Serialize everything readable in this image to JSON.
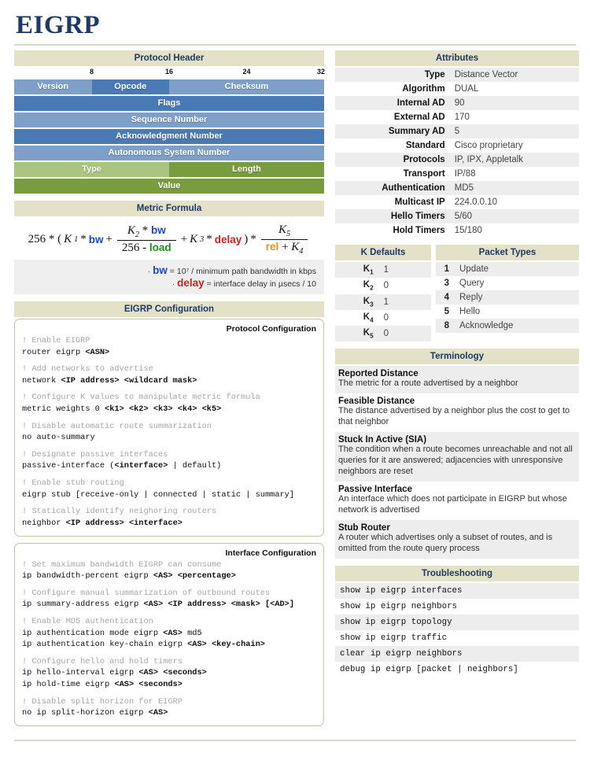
{
  "title": "EIGRP",
  "sections": {
    "protocol_header": "Protocol Header",
    "metric_formula": "Metric Formula",
    "eigrp_configuration": "EIGRP Configuration",
    "attributes": "Attributes",
    "k_defaults": "K Defaults",
    "packet_types": "Packet Types",
    "terminology": "Terminology",
    "troubleshooting": "Troubleshooting"
  },
  "packet_diagram": {
    "ruler": [
      "8",
      "16",
      "24",
      "32"
    ],
    "rows": [
      [
        {
          "label": "Version",
          "width": "w-25",
          "color": "b-light"
        },
        {
          "label": "Opcode",
          "width": "w-25",
          "color": "b-dark"
        },
        {
          "label": "Checksum",
          "width": "w-50",
          "color": "b-light"
        }
      ],
      [
        {
          "label": "Flags",
          "width": "w-100",
          "color": "b-dark"
        }
      ],
      [
        {
          "label": "Sequence Number",
          "width": "w-100",
          "color": "b-light"
        }
      ],
      [
        {
          "label": "Acknowledgment Number",
          "width": "w-100",
          "color": "b-dark"
        }
      ],
      [
        {
          "label": "Autonomous System Number",
          "width": "w-100",
          "color": "b-light"
        }
      ],
      [
        {
          "label": "Type",
          "width": "w-50",
          "color": "g-light"
        },
        {
          "label": "Length",
          "width": "w-50",
          "color": "g-dark"
        }
      ],
      [
        {
          "label": "Value",
          "width": "w-100",
          "color": "g-dark"
        }
      ]
    ]
  },
  "formula": {
    "lead": "256 * (",
    "k1": "K",
    "k1sub": "1",
    "times1": "*",
    "bw1": "bw",
    "plus1": "+",
    "k2": "K",
    "k2sub": "2",
    "times2": "*",
    "bw2": "bw",
    "den_256": "256 -",
    "load": "load",
    "plus2": "+",
    "k3": "K",
    "k3sub": "3",
    "times3": "*",
    "delay": "delay",
    "close": ")",
    "times4": "*",
    "k5": "K",
    "k5sub": "5",
    "rel": "rel",
    "plus3": "+",
    "k4": "K",
    "k4sub": "4",
    "note_bw_label": "bw",
    "note_bw_text": " = 10⁷ / minimum path bandwidth in kbps",
    "note_delay_label": "delay",
    "note_delay_text": " = interface delay in µsecs / 10"
  },
  "config": {
    "protocol": {
      "title": "Protocol Configuration",
      "blocks": [
        {
          "comment": "! Enable EIGRP",
          "lines": [
            {
              "plain": "router eigrp ",
              "bold": "<ASN>"
            }
          ]
        },
        {
          "comment": "! Add networks to advertise",
          "lines": [
            {
              "plain": "network ",
              "bold": "<IP address> <wildcard mask>"
            }
          ]
        },
        {
          "comment": "! Configure K values to manipulate metric formula",
          "lines": [
            {
              "plain": "metric weights 0 ",
              "bold": "<k1> <k2> <k3> <k4> <k5>"
            }
          ]
        },
        {
          "comment": "! Disable automatic route summarization",
          "lines": [
            {
              "plain": "no auto-summary",
              "bold": ""
            }
          ]
        },
        {
          "comment": "! Designate passive interfaces",
          "lines": [
            {
              "plain": "passive-interface (",
              "bold": "<interface>",
              "tail": " | default)"
            }
          ]
        },
        {
          "comment": "! Enable stub routing",
          "lines": [
            {
              "plain": "eigrp stub [receive-only | connected | static | summary]",
              "bold": ""
            }
          ]
        },
        {
          "comment": "! Statically identify neighoring routers",
          "lines": [
            {
              "plain": "neighbor ",
              "bold": "<IP address> <interface>"
            }
          ]
        }
      ]
    },
    "interface": {
      "title": "Interface Configuration",
      "blocks": [
        {
          "comment": "! Set maximum bandwidth EIGRP can consume",
          "lines": [
            {
              "plain": "ip bandwidth-percent eigrp ",
              "bold": "<AS> <percentage>"
            }
          ]
        },
        {
          "comment": "! Configure manual summarization of outbound routes",
          "lines": [
            {
              "plain": "ip summary-address eigrp ",
              "bold": "<AS> <IP address> <mask> [<AD>]"
            }
          ]
        },
        {
          "comment": "! Enable MD5 authentication",
          "lines": [
            {
              "plain": "ip authentication mode eigrp ",
              "bold": "<AS>",
              "tail": " md5"
            },
            {
              "plain": "ip authentication key-chain eigrp ",
              "bold": "<AS> <key-chain>"
            }
          ]
        },
        {
          "comment": "! Configure hello and hold timers",
          "lines": [
            {
              "plain": "ip hello-interval eigrp ",
              "bold": "<AS> <seconds>"
            },
            {
              "plain": "ip hold-time eigrp ",
              "bold": "<AS> <seconds>"
            }
          ]
        },
        {
          "comment": "! Disable split horizon for EIGRP",
          "lines": [
            {
              "plain": "no ip split-horizon eigrp ",
              "bold": "<AS>"
            }
          ]
        }
      ]
    }
  },
  "attributes": [
    {
      "key": "Type",
      "value": "Distance Vector"
    },
    {
      "key": "Algorithm",
      "value": "DUAL"
    },
    {
      "key": "Internal AD",
      "value": "90"
    },
    {
      "key": "External AD",
      "value": "170"
    },
    {
      "key": "Summary AD",
      "value": "5"
    },
    {
      "key": "Standard",
      "value": "Cisco proprietary"
    },
    {
      "key": "Protocols",
      "value": "IP, IPX, Appletalk"
    },
    {
      "key": "Transport",
      "value": "IP/88"
    },
    {
      "key": "Authentication",
      "value": "MD5"
    },
    {
      "key": "Multicast IP",
      "value": "224.0.0.10"
    },
    {
      "key": "Hello Timers",
      "value": "5/60"
    },
    {
      "key": "Hold Timers",
      "value": "15/180"
    }
  ],
  "k_defaults": [
    {
      "label": "K",
      "sub": "1",
      "value": "1"
    },
    {
      "label": "K",
      "sub": "2",
      "value": "0"
    },
    {
      "label": "K",
      "sub": "3",
      "value": "1"
    },
    {
      "label": "K",
      "sub": "4",
      "value": "0"
    },
    {
      "label": "K",
      "sub": "5",
      "value": "0"
    }
  ],
  "packet_types": [
    {
      "num": "1",
      "name": "Update"
    },
    {
      "num": "3",
      "name": "Query"
    },
    {
      "num": "4",
      "name": "Reply"
    },
    {
      "num": "5",
      "name": "Hello"
    },
    {
      "num": "8",
      "name": "Acknowledge"
    }
  ],
  "terminology": [
    {
      "term": "Reported Distance",
      "def": "The metric for a route advertised by a neighbor"
    },
    {
      "term": "Feasible Distance",
      "def": "The distance advertised by a neighbor plus the cost to get to that neighbor"
    },
    {
      "term": "Stuck In Active (SIA)",
      "def": "The condition when a route becomes unreachable and not all queries for it are answered; adjacencies with unresponsive neighbors are reset"
    },
    {
      "term": "Passive Interface",
      "def": "An interface which does not participate in EIGRP but whose network is advertised"
    },
    {
      "term": "Stub Router",
      "def": "A router which advertises only a subset of routes, and is omitted from the route query process"
    }
  ],
  "troubleshooting": [
    "show ip eigrp interfaces",
    "show ip eigrp neighbors",
    "show ip eigrp topology",
    "show ip eigrp traffic",
    "clear ip eigrp neighbors",
    "debug ip eigrp [packet | neighbors]"
  ]
}
